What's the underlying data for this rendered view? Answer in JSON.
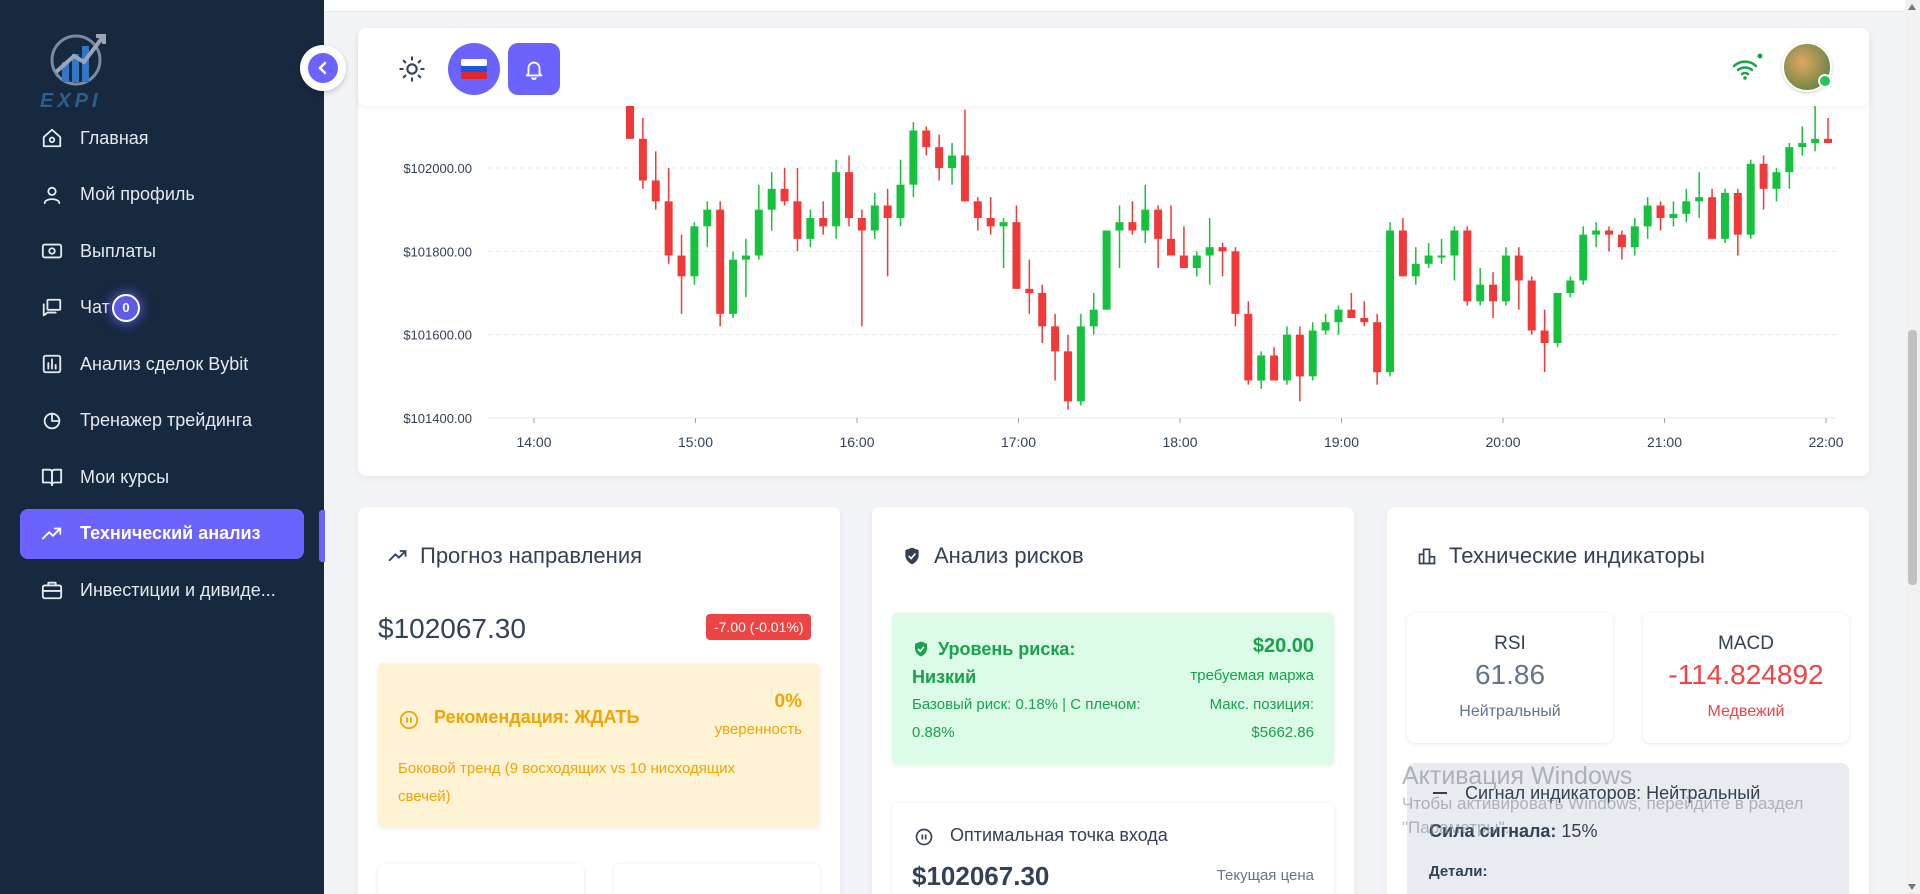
{
  "brand": {
    "logo_text": "EXPI"
  },
  "sidebar": {
    "items": [
      {
        "label": "Главная",
        "icon": "home-icon"
      },
      {
        "label": "Мой профиль",
        "icon": "user-icon"
      },
      {
        "label": "Выплаты",
        "icon": "wallet-icon"
      },
      {
        "label": "Чат",
        "icon": "chat-icon",
        "badge": "0"
      },
      {
        "label": "Анализ сделок Bybit",
        "icon": "bar-chart-icon"
      },
      {
        "label": "Тренажер трейдинга",
        "icon": "pie-icon"
      },
      {
        "label": "Мои курсы",
        "icon": "book-icon"
      },
      {
        "label": "Технический анализ",
        "icon": "trending-icon",
        "active": true
      },
      {
        "label": "Инвестиции и дивиде...",
        "icon": "briefcase-icon"
      }
    ]
  },
  "header": {
    "theme_icon": "sun-icon",
    "lang_icon": "russia-flag-icon",
    "notif_icon": "bell-icon",
    "connection_icon": "wifi-icon"
  },
  "chart_data": {
    "type": "candlestick",
    "ylim": [
      101400,
      102140
    ],
    "yticks": [
      "$101400.00",
      "$101600.00",
      "$101800.00",
      "$102000.00"
    ],
    "xticks": [
      "14:00",
      "15:00",
      "16:00",
      "17:00",
      "18:00",
      "19:00",
      "20:00",
      "21:00",
      "22:00"
    ],
    "up_color": "#16c23d",
    "down_color": "#f03a3a",
    "candles": [
      [
        102170,
        102170,
        102070,
        102070
      ],
      [
        102070,
        102120,
        101950,
        101970
      ],
      [
        101970,
        102040,
        101900,
        101920
      ],
      [
        101920,
        102000,
        101770,
        101790
      ],
      [
        101790,
        101840,
        101650,
        101740
      ],
      [
        101740,
        101870,
        101720,
        101860
      ],
      [
        101860,
        101920,
        101810,
        101900
      ],
      [
        101900,
        101920,
        101620,
        101650
      ],
      [
        101650,
        101800,
        101640,
        101780
      ],
      [
        101780,
        101830,
        101690,
        101790
      ],
      [
        101790,
        101960,
        101780,
        101900
      ],
      [
        101900,
        101990,
        101850,
        101950
      ],
      [
        101950,
        102000,
        101910,
        101920
      ],
      [
        101920,
        102000,
        101800,
        101830
      ],
      [
        101830,
        101900,
        101810,
        101880
      ],
      [
        101880,
        101920,
        101840,
        101860
      ],
      [
        101860,
        102020,
        101830,
        101990
      ],
      [
        101990,
        102030,
        101860,
        101880
      ],
      [
        101880,
        101900,
        101620,
        101850
      ],
      [
        101850,
        101940,
        101830,
        101910
      ],
      [
        101910,
        101950,
        101740,
        101880
      ],
      [
        101880,
        102020,
        101860,
        101960
      ],
      [
        101960,
        102110,
        101930,
        102090
      ],
      [
        102090,
        102100,
        102030,
        102050
      ],
      [
        102050,
        102080,
        101970,
        102000
      ],
      [
        102000,
        102060,
        101960,
        102030
      ],
      [
        102030,
        102140,
        101950,
        101920
      ],
      [
        101920,
        101930,
        101850,
        101880
      ],
      [
        101880,
        101930,
        101840,
        101860
      ],
      [
        101860,
        101880,
        101760,
        101870
      ],
      [
        101870,
        101910,
        101710,
        101710
      ],
      [
        101710,
        101780,
        101650,
        101700
      ],
      [
        101700,
        101720,
        101580,
        101620
      ],
      [
        101620,
        101650,
        101490,
        101560
      ],
      [
        101560,
        101600,
        101420,
        101440
      ],
      [
        101440,
        101650,
        101430,
        101620
      ],
      [
        101620,
        101700,
        101600,
        101660
      ],
      [
        101660,
        101820,
        101660,
        101850
      ],
      [
        101850,
        101910,
        101760,
        101870
      ],
      [
        101870,
        101920,
        101840,
        101850
      ],
      [
        101850,
        101960,
        101820,
        101900
      ],
      [
        101900,
        101910,
        101760,
        101830
      ],
      [
        101830,
        101910,
        101800,
        101790
      ],
      [
        101790,
        101860,
        101770,
        101760
      ],
      [
        101760,
        101800,
        101740,
        101790
      ],
      [
        101790,
        101880,
        101720,
        101810
      ],
      [
        101810,
        101820,
        101740,
        101800
      ],
      [
        101800,
        101810,
        101620,
        101650
      ],
      [
        101650,
        101680,
        101480,
        101490
      ],
      [
        101490,
        101560,
        101470,
        101550
      ],
      [
        101550,
        101570,
        101490,
        101490
      ],
      [
        101490,
        101620,
        101480,
        101600
      ],
      [
        101600,
        101620,
        101440,
        101500
      ],
      [
        101500,
        101630,
        101490,
        101610
      ],
      [
        101610,
        101650,
        101600,
        101630
      ],
      [
        101630,
        101670,
        101600,
        101660
      ],
      [
        101660,
        101700,
        101640,
        101640
      ],
      [
        101640,
        101680,
        101620,
        101630
      ],
      [
        101630,
        101650,
        101480,
        101510
      ],
      [
        101510,
        101870,
        101500,
        101850
      ],
      [
        101850,
        101880,
        101740,
        101740
      ],
      [
        101740,
        101810,
        101720,
        101770
      ],
      [
        101770,
        101820,
        101760,
        101790
      ],
      [
        101790,
        101830,
        101770,
        101790
      ],
      [
        101790,
        101860,
        101730,
        101850
      ],
      [
        101850,
        101860,
        101670,
        101680
      ],
      [
        101680,
        101760,
        101670,
        101720
      ],
      [
        101720,
        101750,
        101640,
        101680
      ],
      [
        101680,
        101810,
        101670,
        101790
      ],
      [
        101790,
        101810,
        101660,
        101730
      ],
      [
        101730,
        101740,
        101600,
        101610
      ],
      [
        101610,
        101660,
        101510,
        101580
      ],
      [
        101580,
        101680,
        101570,
        101700
      ],
      [
        101700,
        101740,
        101690,
        101730
      ],
      [
        101730,
        101860,
        101720,
        101840
      ],
      [
        101840,
        101870,
        101810,
        101850
      ],
      [
        101850,
        101860,
        101800,
        101840
      ],
      [
        101840,
        101850,
        101780,
        101810
      ],
      [
        101810,
        101880,
        101790,
        101860
      ],
      [
        101860,
        101930,
        101830,
        101910
      ],
      [
        101910,
        101920,
        101850,
        101880
      ],
      [
        101880,
        101920,
        101860,
        101890
      ],
      [
        101890,
        101950,
        101870,
        101920
      ],
      [
        101920,
        101990,
        101880,
        101930
      ],
      [
        101930,
        101950,
        101830,
        101830
      ],
      [
        101830,
        101950,
        101820,
        101940
      ],
      [
        101940,
        101950,
        101790,
        101840
      ],
      [
        101840,
        102020,
        101830,
        102010
      ],
      [
        102010,
        102030,
        101900,
        101950
      ],
      [
        101950,
        102000,
        101920,
        101990
      ],
      [
        101990,
        102060,
        101950,
        102050
      ],
      [
        102050,
        102100,
        102030,
        102060
      ],
      [
        102060,
        102150,
        102040,
        102070
      ],
      [
        102070,
        102120,
        102060,
        102060
      ]
    ]
  },
  "forecast": {
    "title": "Прогноз направления",
    "price": "$102067.30",
    "change": "-7.00 (-0.01%)",
    "recommendation": "Рекомендация: ЖДАТЬ",
    "confidence_value": "0%",
    "confidence_label": "уверенность",
    "description": "Боковой тренд (9 восходящих vs 10 нисходящих свечей)"
  },
  "risk": {
    "title": "Анализ рисков",
    "level": "Уровень риска: Низкий",
    "amount": "$20.00",
    "margin_label": "требуемая маржа",
    "base_risk": "Базовый риск: 0.18% | С плечом: 0.88%",
    "max_position_label": "Макс. позиция:",
    "max_position_value": "$5662.86",
    "entry_title": "Оптимальная точка входа",
    "entry_price": "$102067.30",
    "entry_label": "Текущая цена"
  },
  "indicators": {
    "title": "Технические индикаторы",
    "rsi": {
      "name": "RSI",
      "value": "61.86",
      "status": "Нейтральный",
      "color": "#64748b"
    },
    "macd": {
      "name": "MACD",
      "value": "-114.824892",
      "status": "Медвежий",
      "color": "#ef4444"
    },
    "signal_title": "Сигнал индикаторов: Нейтральный",
    "strength_label": "Сила сигнала:",
    "strength_value": "15%",
    "details_label": "Детали:"
  },
  "watermark": {
    "title": "Активация Windows",
    "line1": "Чтобы активировать Windows, перейдите в раздел",
    "line2": "\"Параметры\"."
  },
  "colors": {
    "accent": "#6c63ff",
    "sidebar": "#16293f"
  }
}
